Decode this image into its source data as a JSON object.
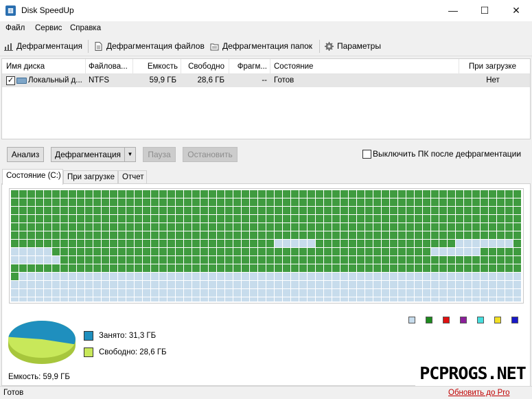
{
  "window": {
    "title": "Disk SpeedUp",
    "icon": "disk-speedup-app-icon",
    "controls": {
      "minimize": "—",
      "maximize": "☐",
      "close": "✕"
    }
  },
  "menu": [
    "Файл",
    "Сервис",
    "Справка"
  ],
  "toolbar": {
    "defrag": "Дефрагментация",
    "defrag_files": "Дефрагментация файлов",
    "defrag_folders": "Дефрагментация папок",
    "settings": "Параметры"
  },
  "disk_list": {
    "columns": [
      "Имя диска",
      "Файлова...",
      "Емкость",
      "Свободно",
      "Фрагм...",
      "Состояние",
      "При загрузке"
    ],
    "rows": [
      {
        "checked": true,
        "name": "Локальный д...",
        "fs": "NTFS",
        "capacity": "59,9 ГБ",
        "free": "28,6 ГБ",
        "fragm": "--",
        "state": "Готов",
        "on_boot": "Нет"
      }
    ]
  },
  "actions": {
    "analyze": "Анализ",
    "defrag": "Дефрагментация",
    "pause": "Пауза",
    "stop": "Остановить",
    "shutdown_option": "Выключить ПК после дефрагментации",
    "shutdown_checked": false
  },
  "tabs": [
    "Состояние (C:)",
    "При загрузке",
    "Отчет"
  ],
  "active_tab": 0,
  "cluster_map": {
    "cols": 62,
    "rows": 16,
    "used_color": "#3f9b3f",
    "free_color": "#c7dcec",
    "fully_used_rows": [
      0,
      1,
      2,
      3,
      4,
      5
    ],
    "row6_free_cols": [
      32,
      33,
      34,
      35,
      36,
      54,
      55,
      56,
      57,
      58,
      59,
      60
    ],
    "row7_free_cols": [
      0,
      1,
      2,
      3,
      4,
      51,
      52,
      53,
      54,
      55,
      56
    ],
    "row8_free_cols": [
      0,
      1,
      2,
      3,
      4,
      5
    ],
    "row10_used_cols": [
      0
    ]
  },
  "legend_colors": [
    "#c7dcec",
    "#1e8a1e",
    "#e01010",
    "#8b1f9a",
    "#46dede",
    "#f2e024",
    "#1818c8"
  ],
  "usage": {
    "used_label": "Занято: 31,3 ГБ",
    "free_label": "Свободно: 28,6 ГБ",
    "capacity_label": "Емкость: 59,9 ГБ",
    "used_color": "#1f8fbe",
    "free_color": "#c8e85a",
    "used_fraction": 0.523
  },
  "status": {
    "text": "Готов",
    "upgrade": "Обновить до Pro"
  },
  "watermark": "PCPROGS.NET"
}
